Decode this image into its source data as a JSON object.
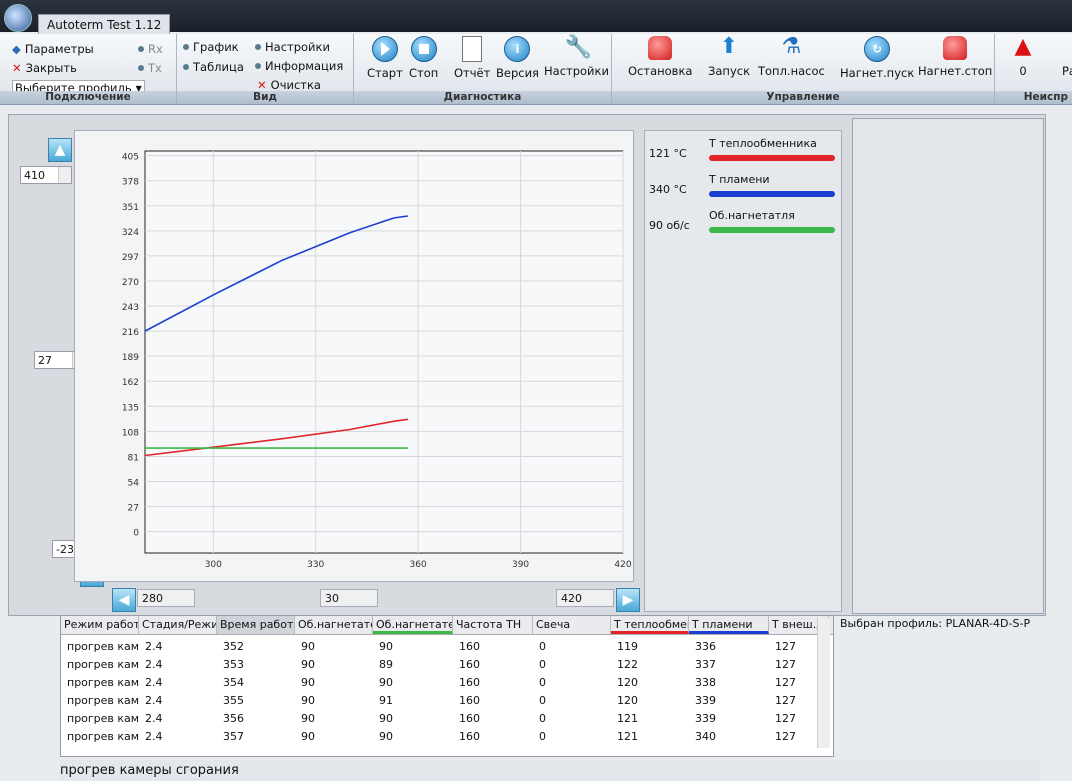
{
  "app": {
    "title": "Autoterm Test 1.12"
  },
  "ribbon": {
    "connection": {
      "label": "Подключение",
      "params": "Параметры",
      "close": "Закрыть",
      "profile": "Выберите профиль",
      "rx": "Rx",
      "tx": "Tx"
    },
    "view": {
      "label": "Вид",
      "graph": "График",
      "table": "Таблица",
      "settings": "Настройки",
      "info": "Информация",
      "clear": "Очистка"
    },
    "diagnostics": {
      "label": "Диагностика",
      "start": "Старт",
      "stop": "Стоп",
      "report": "Отчёт",
      "version": "Версия",
      "settings": "Настройки"
    },
    "control": {
      "label": "Управление",
      "halt": "Остановка",
      "launch": "Запуск",
      "fuel_pump": "Топл.насос",
      "blower_start": "Нагнет.пуск",
      "blower_stop": "Нагнет.стоп"
    },
    "faults": {
      "label": "Неиспр",
      "count": "0",
      "cut": "Ра"
    }
  },
  "axis_controls": {
    "y_max": "410",
    "y_mid": "27",
    "y_min": "-23",
    "x_start": "280",
    "x_step": "30",
    "x_end": "420"
  },
  "chart_data": {
    "type": "line",
    "x": [
      280,
      300,
      320,
      340,
      353,
      357
    ],
    "xlim": [
      280,
      420
    ],
    "ylim": [
      -23,
      410
    ],
    "x_ticks": [
      "300",
      "330",
      "360",
      "390",
      "420"
    ],
    "y_ticks": [
      "405",
      "378",
      "351",
      "324",
      "297",
      "270",
      "243",
      "216",
      "189",
      "162",
      "135",
      "108",
      "81",
      "54",
      "27",
      "0"
    ],
    "series": [
      {
        "name": "Т пламени",
        "color": "#1a3fd1",
        "values": [
          216,
          255,
          292,
          322,
          338,
          340
        ]
      },
      {
        "name": "Т теплообменника",
        "color": "#e3242b",
        "values": [
          82,
          91,
          100,
          110,
          119,
          121
        ]
      },
      {
        "name": "Об.нагнетатля",
        "color": "#3cb84a",
        "values": [
          90,
          90,
          90,
          90,
          90,
          90
        ]
      }
    ]
  },
  "legend": [
    {
      "value": "121 °C",
      "name": "Т теплообменника",
      "color": "#e3242b"
    },
    {
      "value": "340 °C",
      "name": "Т пламени",
      "color": "#1a3fd1"
    },
    {
      "value": "90 об/с",
      "name": "Об.нагнетатля",
      "color": "#3cb84a"
    }
  ],
  "table": {
    "headers": [
      "Режим работы",
      "Стадия/Режим",
      "Время работы",
      "Об.нагнетателя",
      "Об.нагнетателя",
      "Частота ТН",
      "Свеча",
      "Т теплообменника",
      "Т пламени",
      "Т внеш.д"
    ],
    "rows": [
      [
        "прогрев камеры",
        "2.4",
        "352",
        "90",
        "90",
        "160",
        "0",
        "119",
        "336",
        "127"
      ],
      [
        "прогрев камеры",
        "2.4",
        "353",
        "90",
        "89",
        "160",
        "0",
        "122",
        "337",
        "127"
      ],
      [
        "прогрев камеры",
        "2.4",
        "354",
        "90",
        "90",
        "160",
        "0",
        "120",
        "338",
        "127"
      ],
      [
        "прогрев камеры",
        "2.4",
        "355",
        "90",
        "91",
        "160",
        "0",
        "120",
        "339",
        "127"
      ],
      [
        "прогрев камеры",
        "2.4",
        "356",
        "90",
        "90",
        "160",
        "0",
        "121",
        "339",
        "127"
      ],
      [
        "прогрев камеры",
        "2.4",
        "357",
        "90",
        "90",
        "160",
        "0",
        "121",
        "340",
        "127"
      ]
    ]
  },
  "profile": "Выбран профиль: PLANAR-4D-S-P",
  "status": "прогрев камеры сгорания"
}
